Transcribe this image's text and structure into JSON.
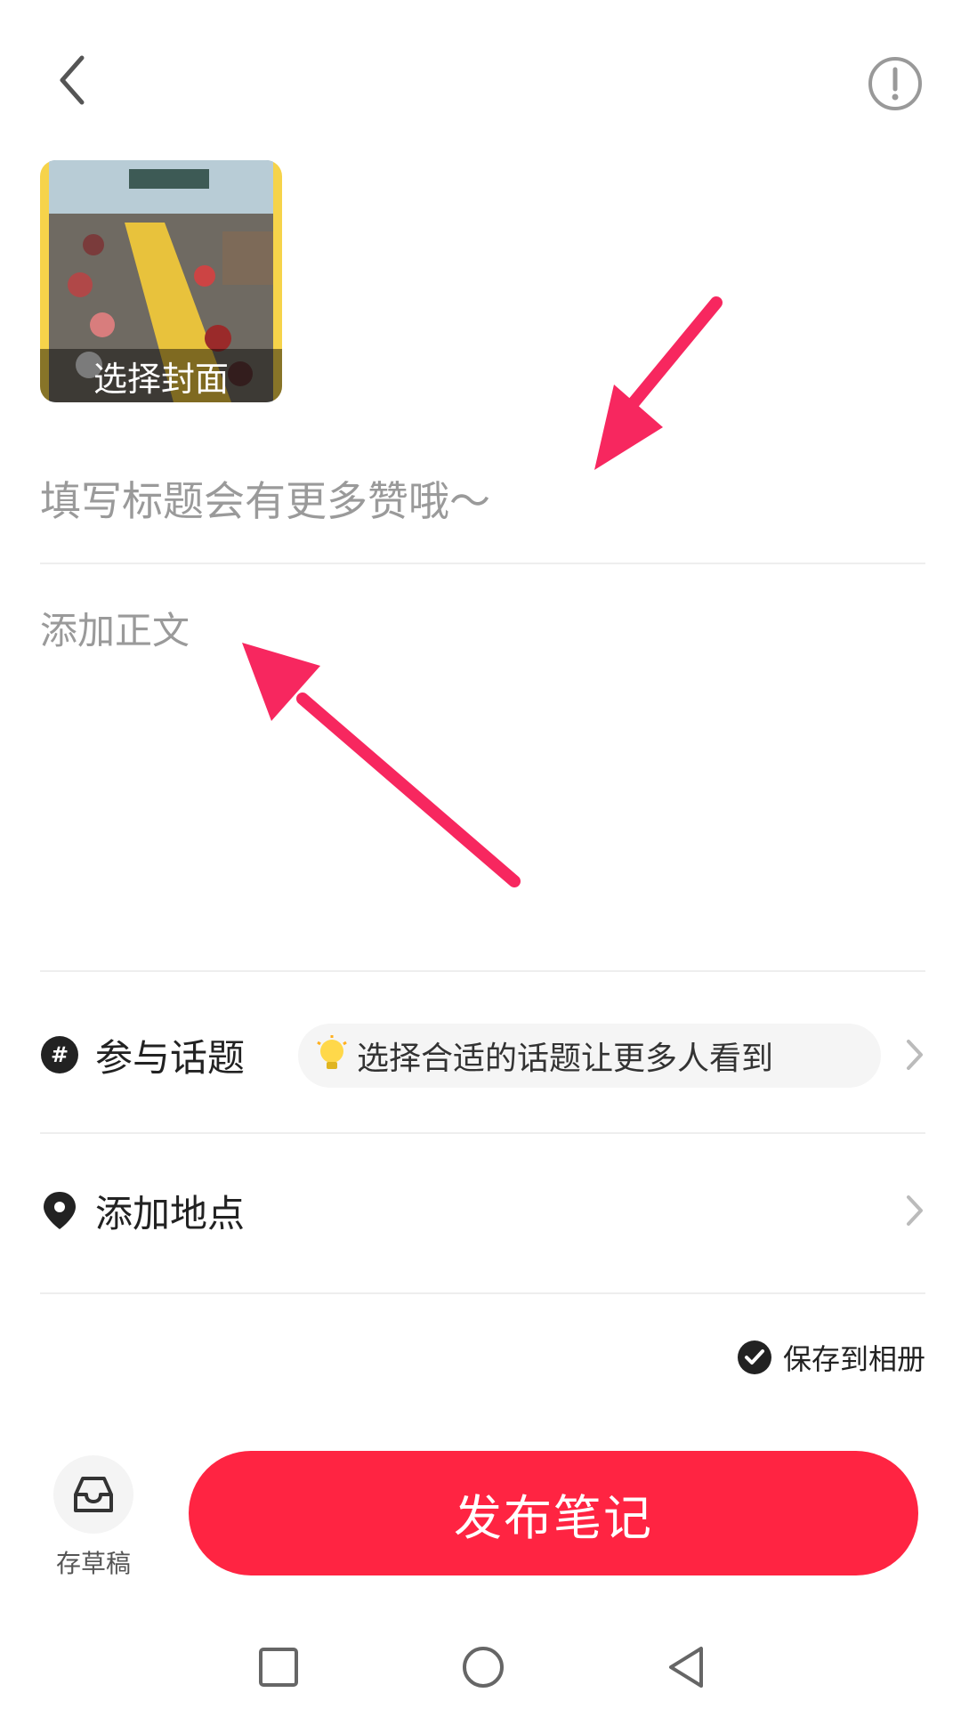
{
  "header": {
    "back_icon": "chevron-left-icon",
    "info_icon": "exclamation-circle-icon"
  },
  "cover": {
    "label": "选择封面"
  },
  "title_field": {
    "placeholder": "填写标题会有更多赞哦～"
  },
  "body_field": {
    "placeholder": "添加正文"
  },
  "topic_row": {
    "icon": "hashtag-icon",
    "label": "参与话题",
    "hint_icon": "lightbulb-icon",
    "hint": "选择合适的话题让更多人看到"
  },
  "location_row": {
    "icon": "location-pin-icon",
    "label": "添加地点"
  },
  "save_album": {
    "label": "保存到相册",
    "checked": true
  },
  "footer": {
    "draft_label": "存草稿",
    "publish_label": "发布笔记"
  },
  "colors": {
    "accent": "#ff2442",
    "annotation_arrow": "#f7275f"
  }
}
